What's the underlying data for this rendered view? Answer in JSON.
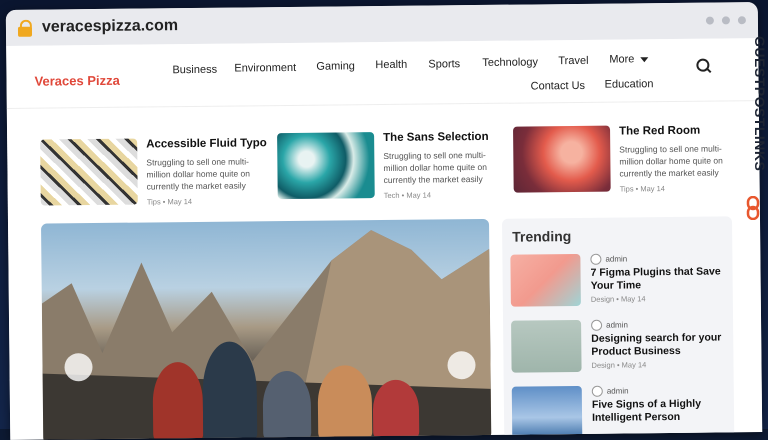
{
  "browser": {
    "url": "veracespizza.com"
  },
  "site": {
    "logo": "Veraces Pizza",
    "nav": [
      "Business",
      "Environment",
      "Gaming",
      "Health",
      "Sports",
      "Technology",
      "Travel",
      "More",
      "Contact Us",
      "Education"
    ]
  },
  "featured": [
    {
      "title": "Accessible Fluid Typo",
      "excerpt": "Struggling to sell one multi-million dollar home quite on currently the market easily",
      "meta": "Tips • May 14"
    },
    {
      "title": "The Sans Selection",
      "excerpt": "Struggling to sell one multi-million dollar home quite on currently the market easily",
      "meta": "Tech • May 14"
    },
    {
      "title": "The Red Room",
      "excerpt": "Struggling to sell one multi-million dollar home quite on currently the market easily",
      "meta": "Tips • May 14"
    }
  ],
  "trending": {
    "heading": "Trending",
    "items": [
      {
        "author": "admin",
        "title": "7 Figma Plugins that Save Your Time",
        "meta": "Design • May 14"
      },
      {
        "author": "admin",
        "title": "Designing search for your Product Business",
        "meta": "Design • May 14"
      },
      {
        "author": "admin",
        "title": "Five Signs of a Highly Intelligent Person",
        "meta": ""
      }
    ]
  },
  "watermark": "GUESTPOSTLINKS"
}
